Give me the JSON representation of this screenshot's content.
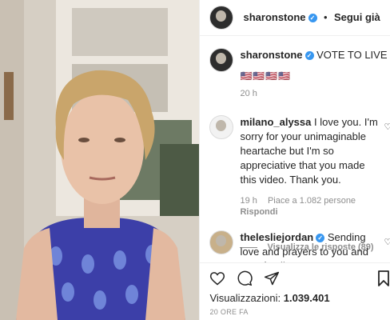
{
  "header": {
    "username": "sharonstone",
    "separator": "•",
    "follow_label": "Segui già"
  },
  "caption": {
    "username": "sharonstone",
    "text": "VOTE TO LIVE",
    "flags": "🇺🇸🇺🇸🇺🇸🇺🇸",
    "time": "20 h"
  },
  "comments": [
    {
      "username": "milano_alyssa",
      "text": "I love you. I'm sorry for your unimaginable heartache but I'm so appreciative that you made this video. Thank you.",
      "time": "19 h",
      "likes": "Piace a 1.082 persone",
      "reply": "Rispondi",
      "view_replies": "Visualizza le risposte (89)"
    },
    {
      "username": "theleslie jordan",
      "text": "Sending love and prayers to you and your family.",
      "time": ""
    }
  ],
  "footer": {
    "views_label": "Visualizzazioni:",
    "views_count": "1.039.401",
    "timestamp": "20 ORE FA"
  },
  "colors": {
    "verified": "#3897f0",
    "text": "#262626",
    "muted": "#8e8e8e"
  }
}
